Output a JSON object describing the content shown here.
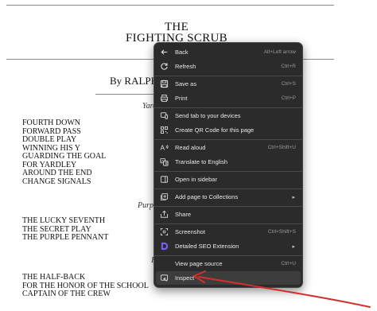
{
  "document": {
    "title_line1": "THE",
    "title_line2": "FIGHTING SCRUB",
    "byline": "By RALPH",
    "section1_label": "Yard",
    "section1_books": [
      "FOURTH DOWN",
      "FORWARD PASS",
      "DOUBLE PLAY",
      "WINNING HIS Y",
      "GUARDING THE GOAL",
      "FOR YARDLEY",
      "AROUND THE END",
      "CHANGE SIGNALS"
    ],
    "section2_label": "Purpl",
    "section2_books": [
      "THE LUCKY SEVENTH",
      "THE SECRET PLAY",
      "THE PURPLE PENNANT"
    ],
    "section3_label": "F",
    "section3_books": [
      "THE HALF-BACK",
      "FOR THE HONOR OF THE SCHOOL",
      "CAPTAIN OF THE CREW"
    ]
  },
  "context_menu": {
    "items": [
      {
        "label": "Back",
        "shortcut": "Alt+Left arrow",
        "icon": "back-arrow-icon"
      },
      {
        "label": "Refresh",
        "shortcut": "Ctrl+R",
        "icon": "refresh-icon"
      },
      {
        "label": "Save as",
        "shortcut": "Ctrl+S",
        "icon": "save-icon"
      },
      {
        "label": "Print",
        "shortcut": "Ctrl+P",
        "icon": "print-icon"
      },
      {
        "label": "Send tab to your devices",
        "shortcut": "",
        "icon": "send-tab-icon"
      },
      {
        "label": "Create QR Code for this page",
        "shortcut": "",
        "icon": "qr-code-icon"
      },
      {
        "label": "Read aloud",
        "shortcut": "Ctrl+Shift+U",
        "icon": "read-aloud-icon"
      },
      {
        "label": "Translate to English",
        "shortcut": "",
        "icon": "translate-icon"
      },
      {
        "label": "Open in sidebar",
        "shortcut": "",
        "icon": "sidebar-icon"
      },
      {
        "label": "Add page to Collections",
        "shortcut": "",
        "icon": "collections-icon"
      },
      {
        "label": "Share",
        "shortcut": "",
        "icon": "share-icon"
      },
      {
        "label": "Screenshot",
        "shortcut": "Ctrl+Shift+S",
        "icon": "screenshot-icon"
      },
      {
        "label": "Detailed SEO Extension",
        "shortcut": "",
        "icon": "seo-extension-icon"
      },
      {
        "label": "View page source",
        "shortcut": "Ctrl+U",
        "icon": "view-source-icon"
      },
      {
        "label": "Inspect",
        "shortcut": "",
        "icon": "inspect-icon"
      }
    ]
  },
  "colors": {
    "menu_bg": "#2b2b2b",
    "menu_text": "#e8e8e8",
    "shortcut_text": "#9a9a9a",
    "highlight": "#3d3d3d",
    "annotation_red": "#d32f2f",
    "seo_icon": "#7b5cf0"
  }
}
